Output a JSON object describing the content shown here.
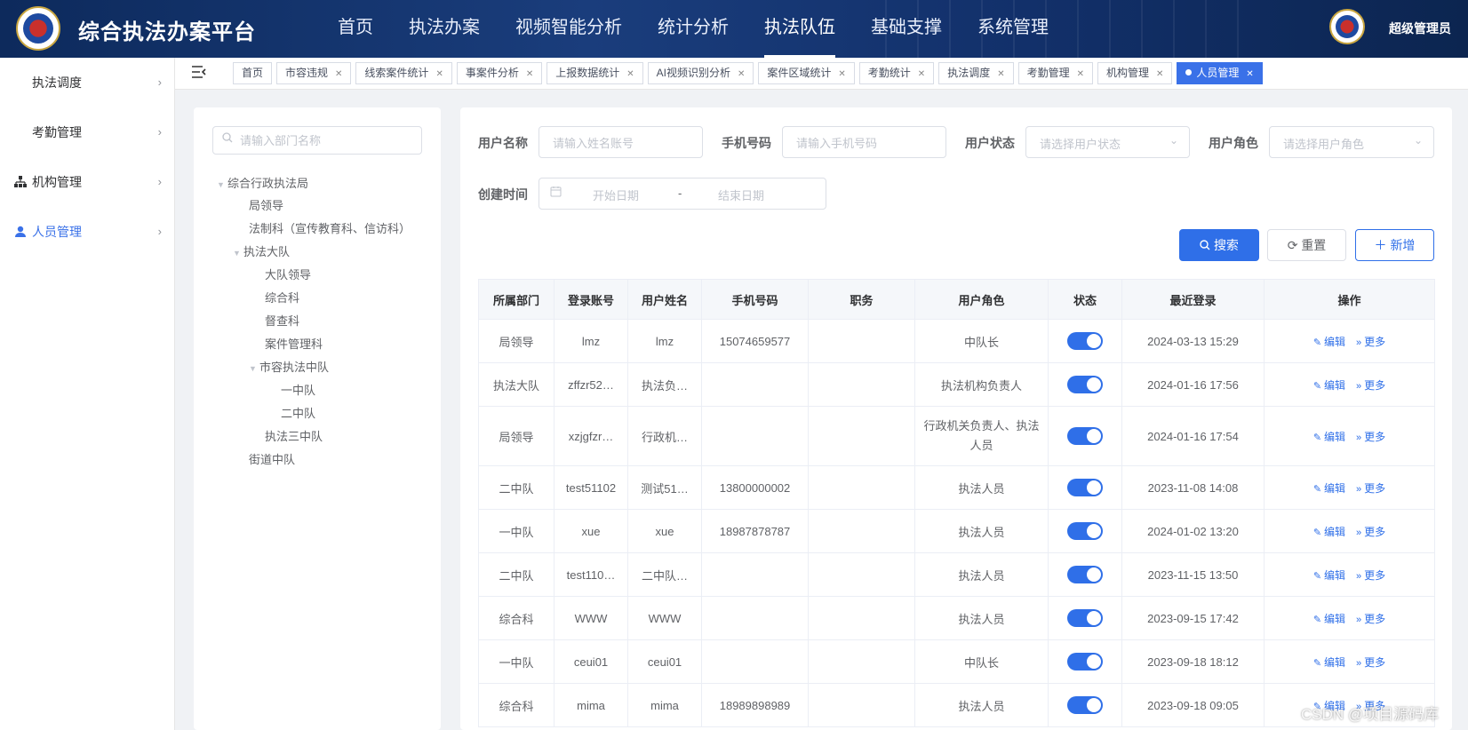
{
  "app": {
    "title": "综合执法办案平台",
    "user": "超级管理员"
  },
  "nav": [
    "首页",
    "执法办案",
    "视频智能分析",
    "统计分析",
    "执法队伍",
    "基础支撑",
    "系统管理"
  ],
  "sidebar": [
    {
      "label": "执法调度",
      "icon": ""
    },
    {
      "label": "考勤管理",
      "icon": ""
    },
    {
      "label": "机构管理",
      "icon": "org-icon"
    },
    {
      "label": "人员管理",
      "icon": "user-icon"
    }
  ],
  "tabs": [
    "首页",
    "市容违规",
    "线索案件统计",
    "事案件分析",
    "上报数据统计",
    "AI视频识别分析",
    "案件区域统计",
    "考勤统计",
    "执法调度",
    "考勤管理",
    "机构管理",
    "人员管理"
  ],
  "tree": {
    "search_placeholder": "请输入部门名称",
    "nodes": [
      "综合行政执法局",
      "局领导",
      "法制科（宣传教育科、信访科）",
      "执法大队",
      "大队领导",
      "综合科",
      "督查科",
      "案件管理科",
      "市容执法中队",
      "一中队",
      "二中队",
      "执法三中队",
      "街道中队"
    ]
  },
  "filters": {
    "username_label": "用户名称",
    "username_placeholder": "请输入姓名账号",
    "phone_label": "手机号码",
    "phone_placeholder": "请输入手机号码",
    "status_label": "用户状态",
    "status_placeholder": "请选择用户状态",
    "role_label": "用户角色",
    "role_placeholder": "请选择用户角色",
    "created_label": "创建时间",
    "start_placeholder": "开始日期",
    "range_sep": "-",
    "end_placeholder": "结束日期"
  },
  "buttons": {
    "search": "搜索",
    "reset": "重置",
    "add": "新增"
  },
  "table": {
    "columns": [
      "所属部门",
      "登录账号",
      "用户姓名",
      "手机号码",
      "职务",
      "用户角色",
      "状态",
      "最近登录",
      "操作"
    ],
    "edit_label": "编辑",
    "more_label": "更多",
    "rows": [
      {
        "dept": "局领导",
        "account": "lmz",
        "name": "lmz",
        "phone": "15074659577",
        "post": "",
        "role": "中队长",
        "last": "2024-03-13 15:29"
      },
      {
        "dept": "执法大队",
        "account": "zffzr52…",
        "name": "执法负…",
        "phone": "",
        "post": "",
        "role": "执法机构负责人",
        "last": "2024-01-16 17:56"
      },
      {
        "dept": "局领导",
        "account": "xzjgfzr…",
        "name": "行政机…",
        "phone": "",
        "post": "",
        "role": "行政机关负责人、执法人员",
        "last": "2024-01-16 17:54"
      },
      {
        "dept": "二中队",
        "account": "test51102",
        "name": "测试51…",
        "phone": "13800000002",
        "post": "",
        "role": "执法人员",
        "last": "2023-11-08 14:08"
      },
      {
        "dept": "一中队",
        "account": "xue",
        "name": "xue",
        "phone": "18987878787",
        "post": "",
        "role": "执法人员",
        "last": "2024-01-02 13:20"
      },
      {
        "dept": "二中队",
        "account": "test110…",
        "name": "二中队…",
        "phone": "",
        "post": "",
        "role": "执法人员",
        "last": "2023-11-15 13:50"
      },
      {
        "dept": "综合科",
        "account": "WWW",
        "name": "WWW",
        "phone": "",
        "post": "",
        "role": "执法人员",
        "last": "2023-09-15 17:42"
      },
      {
        "dept": "一中队",
        "account": "ceui01",
        "name": "ceui01",
        "phone": "",
        "post": "",
        "role": "中队长",
        "last": "2023-09-18 18:12"
      },
      {
        "dept": "综合科",
        "account": "mima",
        "name": "mima",
        "phone": "18989898989",
        "post": "",
        "role": "执法人员",
        "last": "2023-09-18 09:05"
      }
    ]
  },
  "watermark": "CSDN @项目源码库",
  "colors": {
    "primary": "#2f6fe8",
    "header": "#12306a"
  }
}
